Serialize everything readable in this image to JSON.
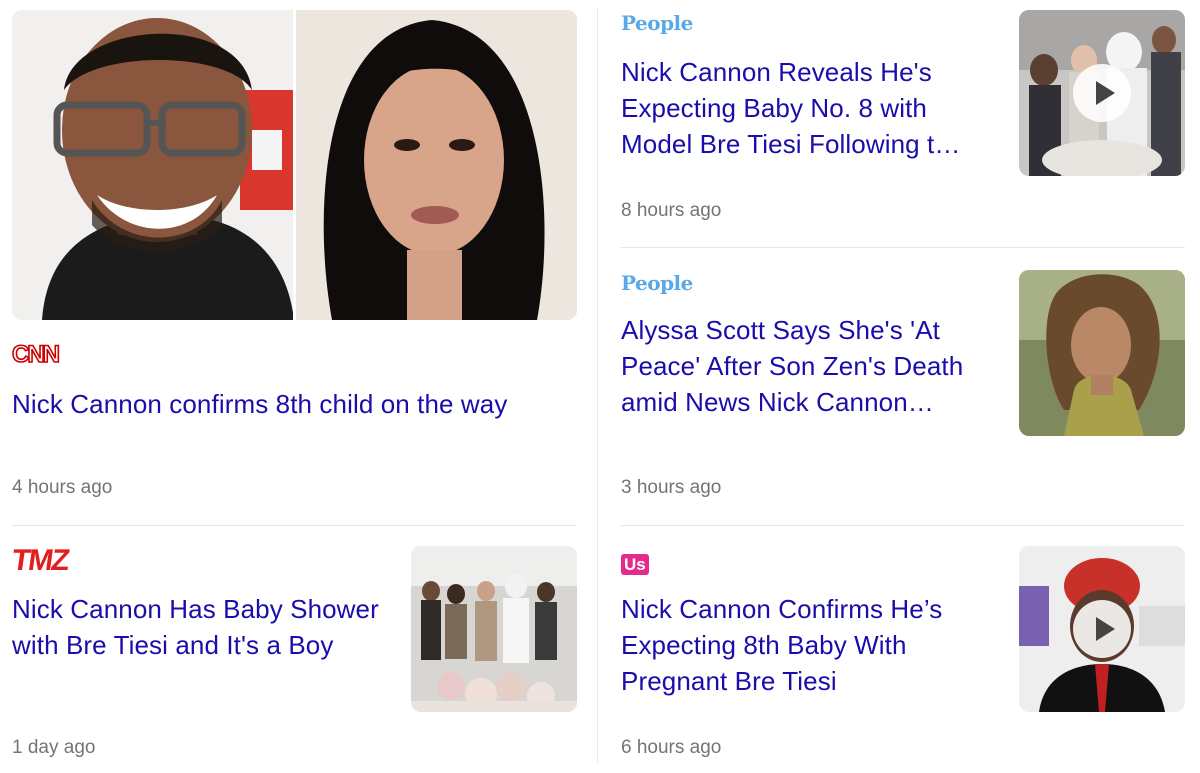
{
  "articles": [
    {
      "source": "CNN",
      "headline": "Nick Cannon confirms 8th child on the way",
      "time": "4 hours ago"
    },
    {
      "source": "People",
      "headline": "Nick Cannon Reveals He's Expecting Baby No. 8 with Model Bre Tiesi Following t…",
      "time": "8 hours ago",
      "video": true
    },
    {
      "source": "People",
      "headline": "Alyssa Scott Says She's 'At Peace' After Son Zen's Death amid News Nick Cannon…",
      "time": "3 hours ago"
    },
    {
      "source": "TMZ",
      "headline": "Nick Cannon Has Baby Shower with Bre Tiesi and It's a Boy",
      "time": "1 day ago"
    },
    {
      "source": "Us",
      "headline": "Nick Cannon Confirms He’s Expecting 8th Baby With Pregnant Bre Tiesi",
      "time": "6 hours ago",
      "video": true
    }
  ],
  "icons": {
    "play": "play-icon"
  },
  "colors": {
    "headline": "#1a0dab",
    "time": "#70757a",
    "divider": "#e6e6e6"
  }
}
